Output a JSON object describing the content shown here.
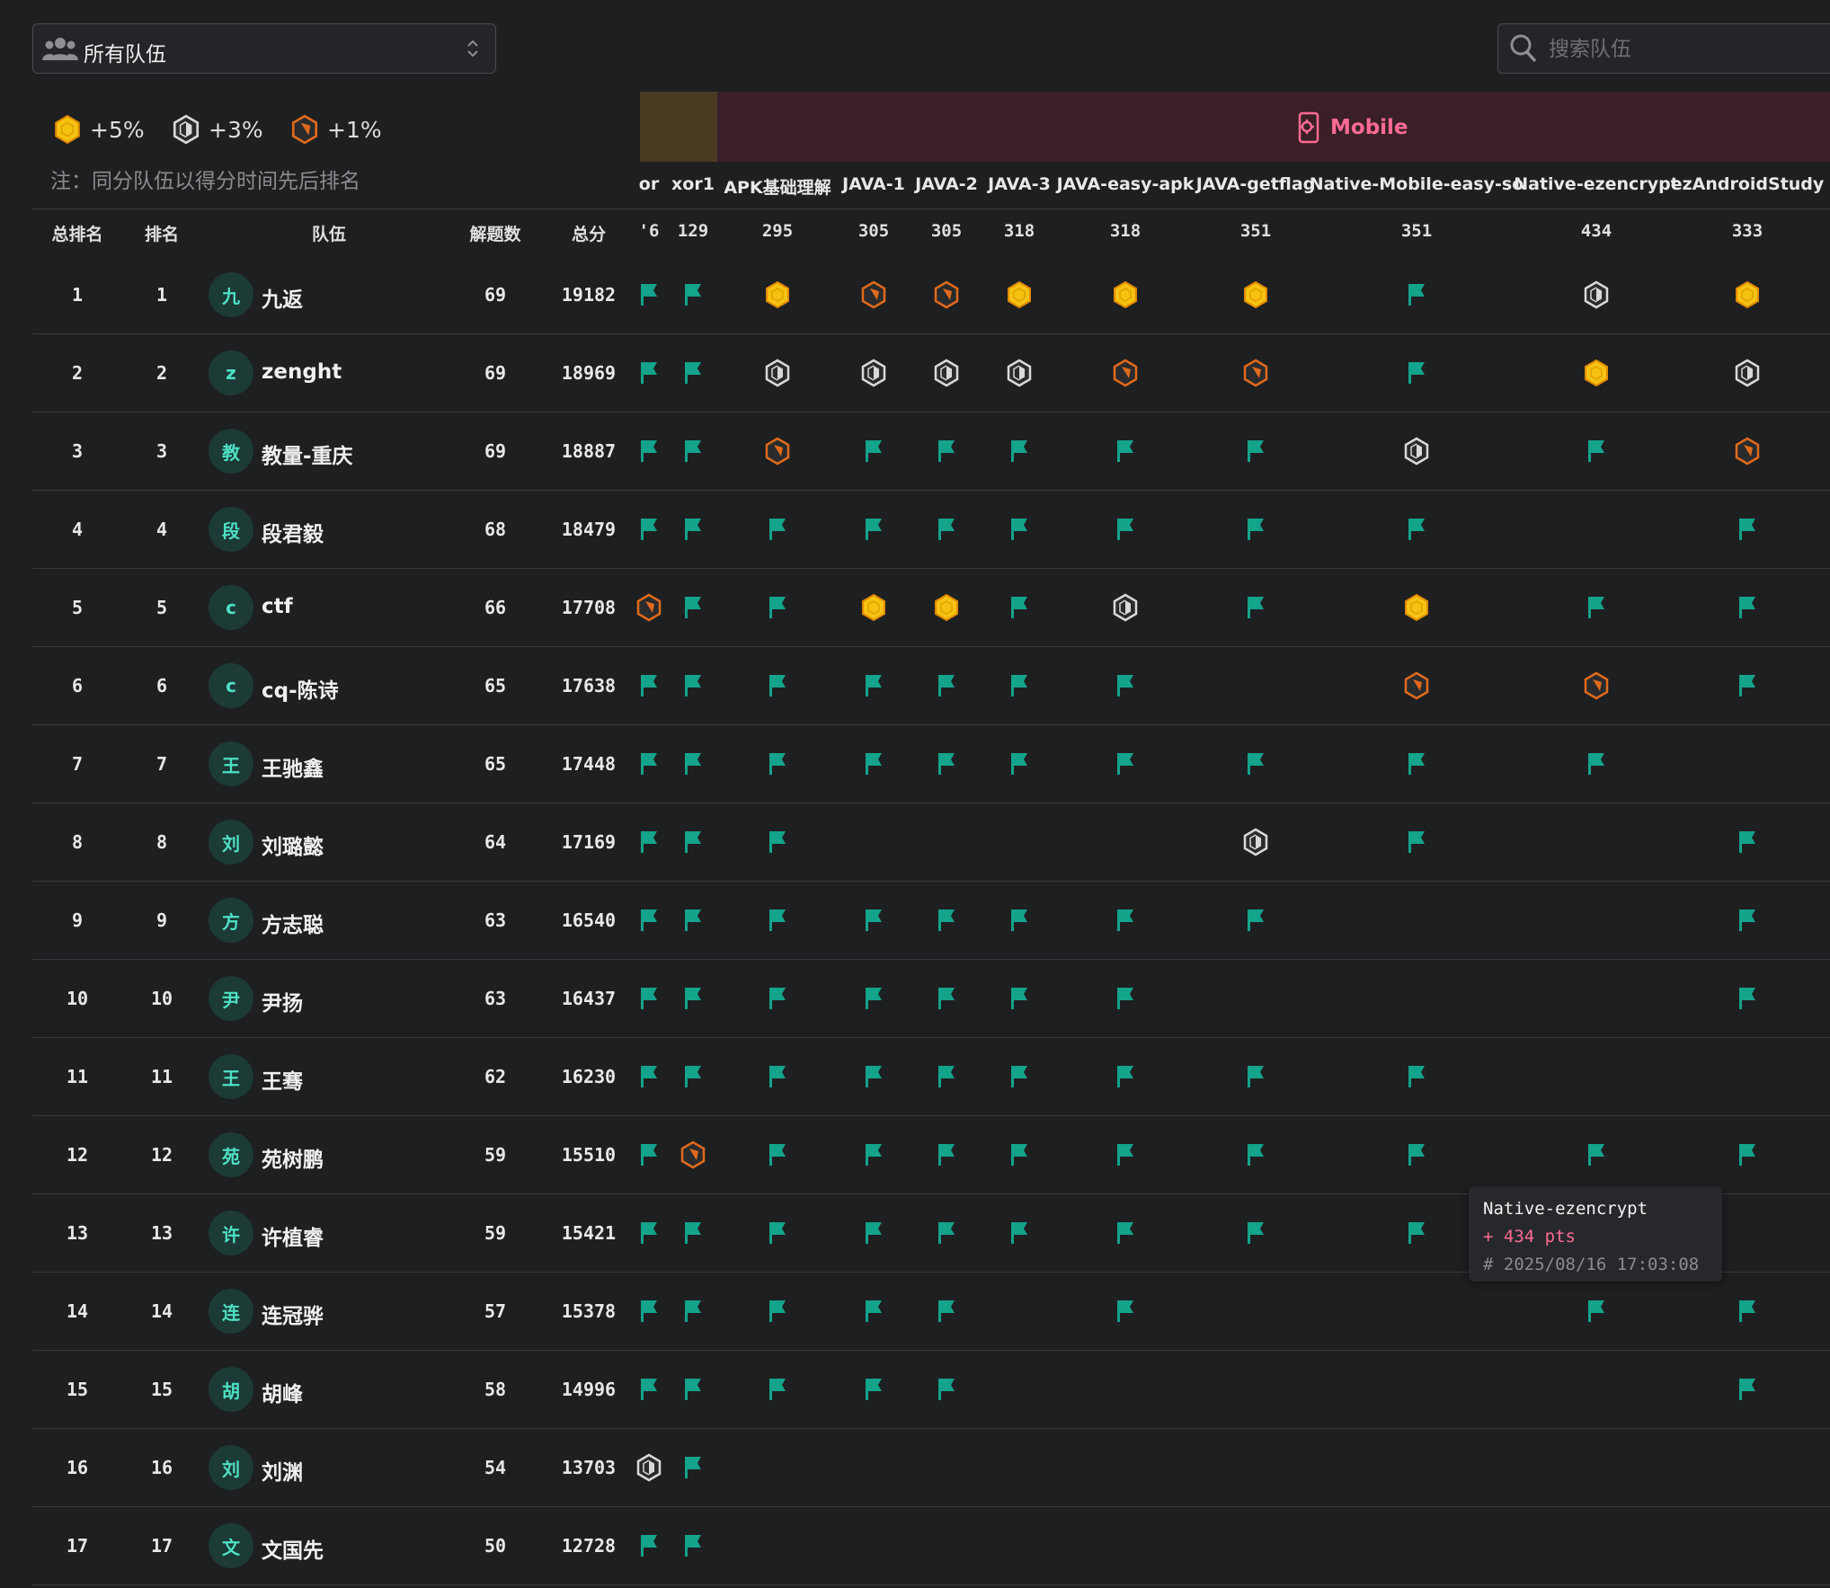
{
  "team_select": {
    "label": "所有队伍",
    "icon": "people-icon"
  },
  "search": {
    "placeholder": "搜索队伍",
    "icon": "search-icon"
  },
  "bonuses": [
    {
      "medal": "gold",
      "label": "+5%"
    },
    {
      "medal": "silver",
      "label": "+3%"
    },
    {
      "medal": "bronze",
      "label": "+1%"
    }
  ],
  "note": "注：同分队伍以得分时间先后排名",
  "category": {
    "name": "Mobile",
    "icon": "mobile-settings-icon",
    "color": "#ff6b93"
  },
  "colors": {
    "background": "#1e1f21",
    "flag": "#14a38b",
    "gold": "#f5c211",
    "silver": "#d9d9d9",
    "bronze": "#e06a1b",
    "mobile_band": "#3a1f28",
    "prev_band": "#4a3a22"
  },
  "headers": {
    "total_rank": "总排名",
    "rank": "排名",
    "team": "队伍",
    "solved": "解题数",
    "score": "总分"
  },
  "challenges": [
    {
      "name": "or",
      "points": "'6"
    },
    {
      "name": "xor1",
      "points": "129"
    },
    {
      "name": "APK基础理解",
      "points": "295"
    },
    {
      "name": "JAVA-1",
      "points": "305"
    },
    {
      "name": "JAVA-2",
      "points": "305"
    },
    {
      "name": "JAVA-3",
      "points": "318"
    },
    {
      "name": "JAVA-easy-apk",
      "points": "318"
    },
    {
      "name": "JAVA-getflag",
      "points": "351"
    },
    {
      "name": "Native-Mobile-easy-so",
      "points": "351"
    },
    {
      "name": "Native-ezencrypt",
      "points": "434"
    },
    {
      "name": "ezAndroidStudy",
      "points": "333"
    }
  ],
  "rows": [
    {
      "total_rank": "1",
      "rank": "1",
      "avatar": "九",
      "team": "九返",
      "solved": "69",
      "score": "19182",
      "marks": [
        "f",
        "f",
        "G",
        "B",
        "B",
        "G",
        "G",
        "G",
        "f",
        "S",
        "G"
      ]
    },
    {
      "total_rank": "2",
      "rank": "2",
      "avatar": "z",
      "team": "zenght",
      "solved": "69",
      "score": "18969",
      "marks": [
        "f",
        "f",
        "S",
        "S",
        "S",
        "S",
        "B",
        "B",
        "f",
        "G",
        "S"
      ]
    },
    {
      "total_rank": "3",
      "rank": "3",
      "avatar": "教",
      "team": "教量-重庆",
      "solved": "69",
      "score": "18887",
      "marks": [
        "f",
        "f",
        "B",
        "f",
        "f",
        "f",
        "f",
        "f",
        "S",
        "f",
        "B"
      ]
    },
    {
      "total_rank": "4",
      "rank": "4",
      "avatar": "段",
      "team": "段君毅",
      "solved": "68",
      "score": "18479",
      "marks": [
        "f",
        "f",
        "f",
        "f",
        "f",
        "f",
        "f",
        "f",
        "f",
        "",
        "f"
      ]
    },
    {
      "total_rank": "5",
      "rank": "5",
      "avatar": "c",
      "team": "ctf",
      "solved": "66",
      "score": "17708",
      "marks": [
        "B",
        "f",
        "f",
        "G",
        "G",
        "f",
        "S",
        "f",
        "G",
        "f",
        "f"
      ]
    },
    {
      "total_rank": "6",
      "rank": "6",
      "avatar": "c",
      "team": "cq-陈诗",
      "solved": "65",
      "score": "17638",
      "marks": [
        "f",
        "f",
        "f",
        "f",
        "f",
        "f",
        "f",
        "",
        "B",
        "B",
        "f"
      ]
    },
    {
      "total_rank": "7",
      "rank": "7",
      "avatar": "王",
      "team": "王驰鑫",
      "solved": "65",
      "score": "17448",
      "marks": [
        "f",
        "f",
        "f",
        "f",
        "f",
        "f",
        "f",
        "f",
        "f",
        "f",
        ""
      ]
    },
    {
      "total_rank": "8",
      "rank": "8",
      "avatar": "刘",
      "team": "刘璐懿",
      "solved": "64",
      "score": "17169",
      "marks": [
        "f",
        "f",
        "f",
        "",
        "",
        "",
        "",
        "S",
        "f",
        "",
        "f"
      ]
    },
    {
      "total_rank": "9",
      "rank": "9",
      "avatar": "方",
      "team": "方志聪",
      "solved": "63",
      "score": "16540",
      "marks": [
        "f",
        "f",
        "f",
        "f",
        "f",
        "f",
        "f",
        "f",
        "",
        "",
        "f"
      ]
    },
    {
      "total_rank": "10",
      "rank": "10",
      "avatar": "尹",
      "team": "尹扬",
      "solved": "63",
      "score": "16437",
      "marks": [
        "f",
        "f",
        "f",
        "f",
        "f",
        "f",
        "f",
        "",
        "",
        "",
        "f"
      ]
    },
    {
      "total_rank": "11",
      "rank": "11",
      "avatar": "王",
      "team": "王骞",
      "solved": "62",
      "score": "16230",
      "marks": [
        "f",
        "f",
        "f",
        "f",
        "f",
        "f",
        "f",
        "f",
        "f",
        "",
        ""
      ]
    },
    {
      "total_rank": "12",
      "rank": "12",
      "avatar": "苑",
      "team": "苑树鹏",
      "solved": "59",
      "score": "15510",
      "marks": [
        "f",
        "B",
        "f",
        "f",
        "f",
        "f",
        "f",
        "f",
        "f",
        "f",
        "f"
      ]
    },
    {
      "total_rank": "13",
      "rank": "13",
      "avatar": "许",
      "team": "许植睿",
      "solved": "59",
      "score": "15421",
      "marks": [
        "f",
        "f",
        "f",
        "f",
        "f",
        "f",
        "f",
        "f",
        "f",
        "",
        ""
      ]
    },
    {
      "total_rank": "14",
      "rank": "14",
      "avatar": "连",
      "team": "连冠骅",
      "solved": "57",
      "score": "15378",
      "marks": [
        "f",
        "f",
        "f",
        "f",
        "f",
        "",
        "f",
        "",
        "",
        "f",
        "f"
      ]
    },
    {
      "total_rank": "15",
      "rank": "15",
      "avatar": "胡",
      "team": "胡峰",
      "solved": "58",
      "score": "14996",
      "marks": [
        "f",
        "f",
        "f",
        "f",
        "f",
        "",
        "",
        "",
        "",
        "",
        "f"
      ]
    },
    {
      "total_rank": "16",
      "rank": "16",
      "avatar": "刘",
      "team": "刘渊",
      "solved": "54",
      "score": "13703",
      "marks": [
        "S",
        "f",
        "",
        "",
        "",
        "",
        "",
        "",
        "",
        "",
        ""
      ]
    },
    {
      "total_rank": "17",
      "rank": "17",
      "avatar": "文",
      "team": "文国先",
      "solved": "50",
      "score": "12728",
      "marks": [
        "f",
        "f",
        "",
        "",
        "",
        "",
        "",
        "",
        "",
        "",
        ""
      ]
    }
  ],
  "tooltip": {
    "title": "Native-ezencrypt",
    "points": "+ 434 pts",
    "time": "# 2025/08/16 17:03:08"
  }
}
